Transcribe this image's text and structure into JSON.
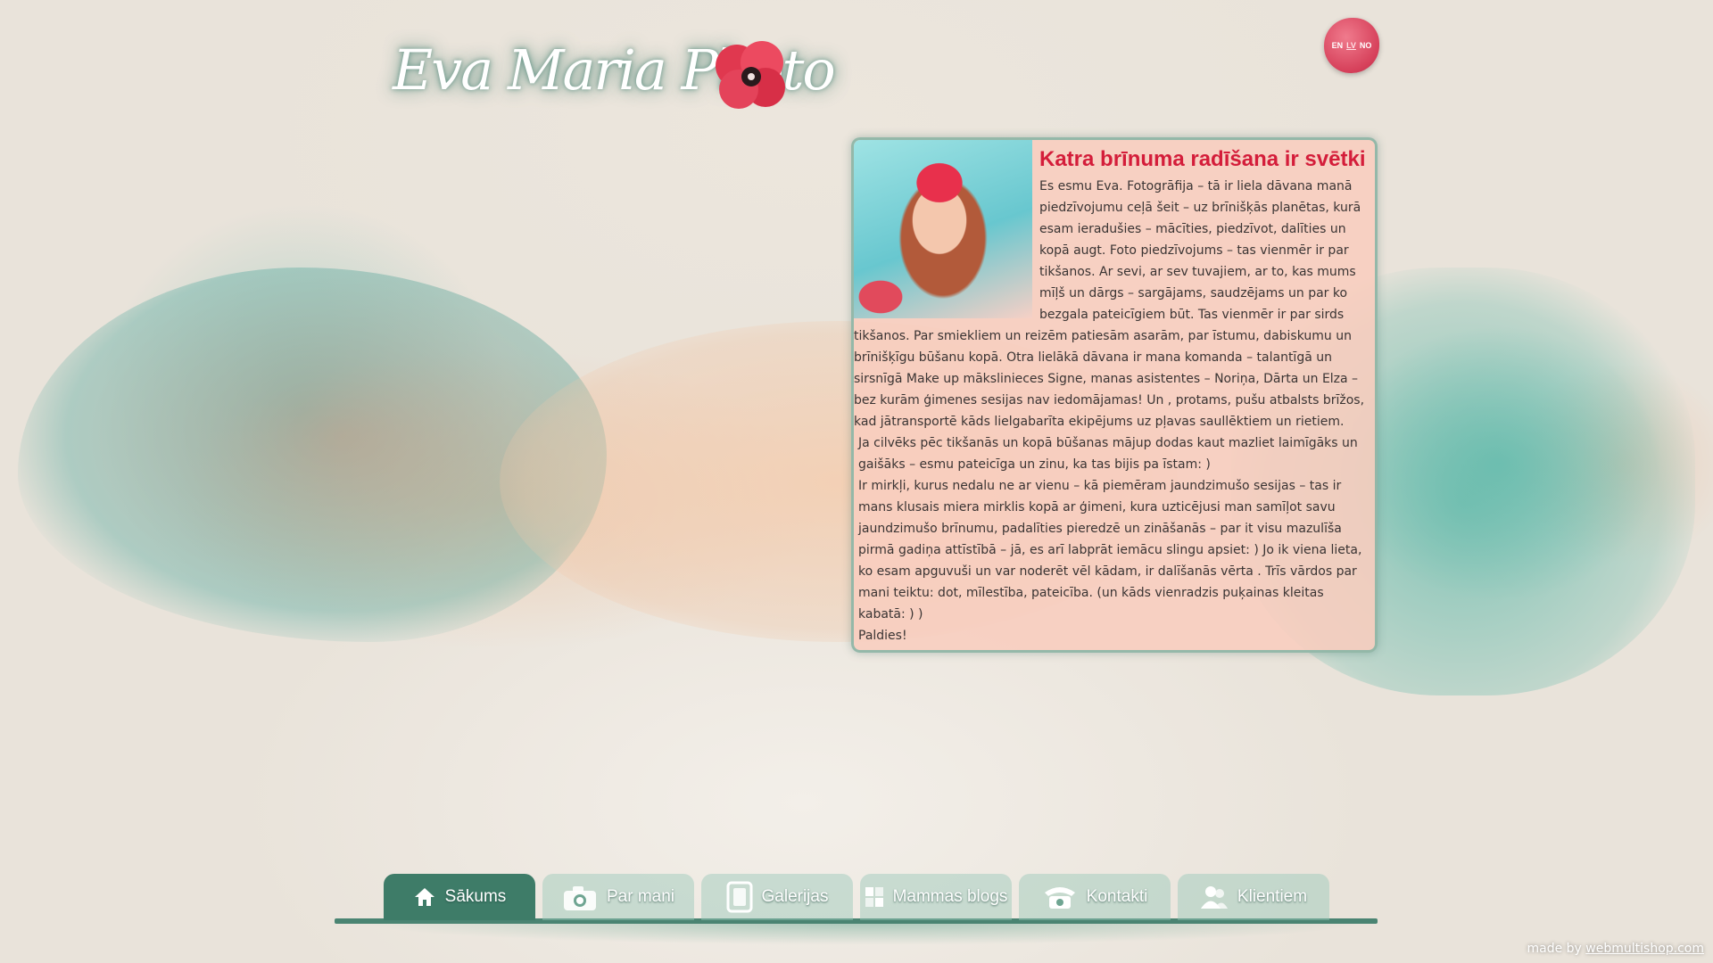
{
  "logo": {
    "text": "Eva Maria Photo",
    "icon": "poppy-flower-icon"
  },
  "languages": [
    {
      "code": "EN",
      "active": false
    },
    {
      "code": "LV",
      "active": true
    },
    {
      "code": "NO",
      "active": false
    }
  ],
  "content": {
    "title": "Katra brīnuma radīšana ir svētki",
    "paragraphs": [
      "Es esmu Eva. Fotogrāfija – tā ir liela dāvana manā piedzīvojumu ceļā šeit – uz brīnišķās planētas, kurā esam ieradušies – mācīties, piedzīvot, dalīties un kopā augt. Foto piedzīvojums – tas vienmēr ir par tikšanos. Ar sevi, ar sev tuvajiem, ar to, kas mums mīļš un dārgs – sargājams, saudzējams un par ko bezgala pateicīgiem būt. Tas vienmēr ir par sirds tikšanos. Par smiekliem un reizēm patiesām asarām, par īstumu, dabiskumu un brīnišķīgu būšanu kopā. Otra lielākā dāvana ir mana komanda – talantīgā un sirsnīgā Make up mākslinieces Signe, manas asistentes – Noriņa, Dārta un Elza – bez kurām ģimenes sesijas nav iedomājamas! Un , protams, pušu atbalsts brīžos, kad jātransportē kāds lielgabarīta ekipējums uz pļavas saullēktiem un rietiem.",
      "Ja cilvēks pēc tikšanās un kopā būšanas mājup dodas kaut mazliet laimīgāks un gaišāks – esmu pateicīga un zinu, ka tas bijis pa īstam: )",
      "Ir mirkļi, kurus nedalu ne ar vienu – kā piemēram jaundzimušo sesijas – tas ir mans klusais miera mirklis kopā ar ģimeni, kura uzticējusi man samīļot savu jaundzimušo brīnumu, padalīties pieredzē un zināšanās – par it visu mazulīša pirmā gadiņa attīstībā – jā, es arī labprāt iemācu slingu apsiet: ) Jo ik viena lieta, ko esam apguvuši un var noderēt vēl kādam, ir dalīšanās vērta . Trīs vārdos par mani teiktu: dot, mīlestība, pateicība. (un kāds vienradzis puķainas kleitas kabatā: ) )",
      "Paldies!"
    ]
  },
  "nav": [
    {
      "label": "Sākums",
      "icon": "home-icon",
      "active": true
    },
    {
      "label": "Par mani",
      "icon": "camera-icon",
      "active": false
    },
    {
      "label": "Galerijas",
      "icon": "photo-frame-icon",
      "active": false
    },
    {
      "label": "Mammas blogs",
      "icon": "blog-grid-icon",
      "active": false
    },
    {
      "label": "Kontakti",
      "icon": "telephone-icon",
      "active": false
    },
    {
      "label": "Klientiem",
      "icon": "users-icon",
      "active": false
    }
  ],
  "footer": {
    "prefix": "made by",
    "link": "webmultishop.com"
  },
  "colors": {
    "accent_red": "#d41d3a",
    "nav_green": "#3e7c68",
    "card_bg": "#f8cdbe"
  }
}
